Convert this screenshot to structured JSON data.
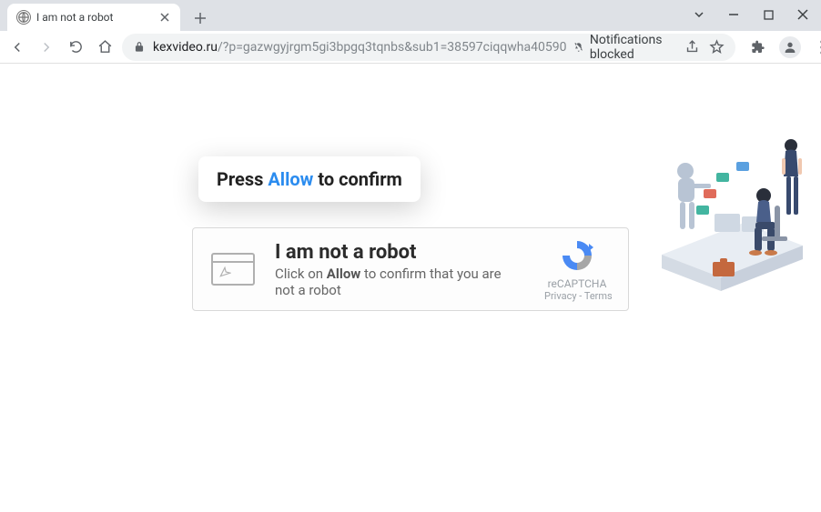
{
  "browser": {
    "tab": {
      "title": "I am not a robot"
    },
    "url_domain": "kexvideo.ru",
    "url_path": "/?p=gazwgyjrgm5gi3bpgq3tqnbs&sub1=38597ciqqwha40590",
    "notifications_blocked_label": "Notifications blocked"
  },
  "page": {
    "press_allow": {
      "prefix": "Press ",
      "highlight": "Allow",
      "suffix": " to confirm"
    },
    "captcha": {
      "title": "I am not a robot",
      "sub_prefix": "Click on ",
      "sub_bold": "Allow",
      "sub_suffix": " to confirm that you are not a robot",
      "badge_label": "reCAPTCHA",
      "badge_links": "Privacy - Terms"
    }
  }
}
